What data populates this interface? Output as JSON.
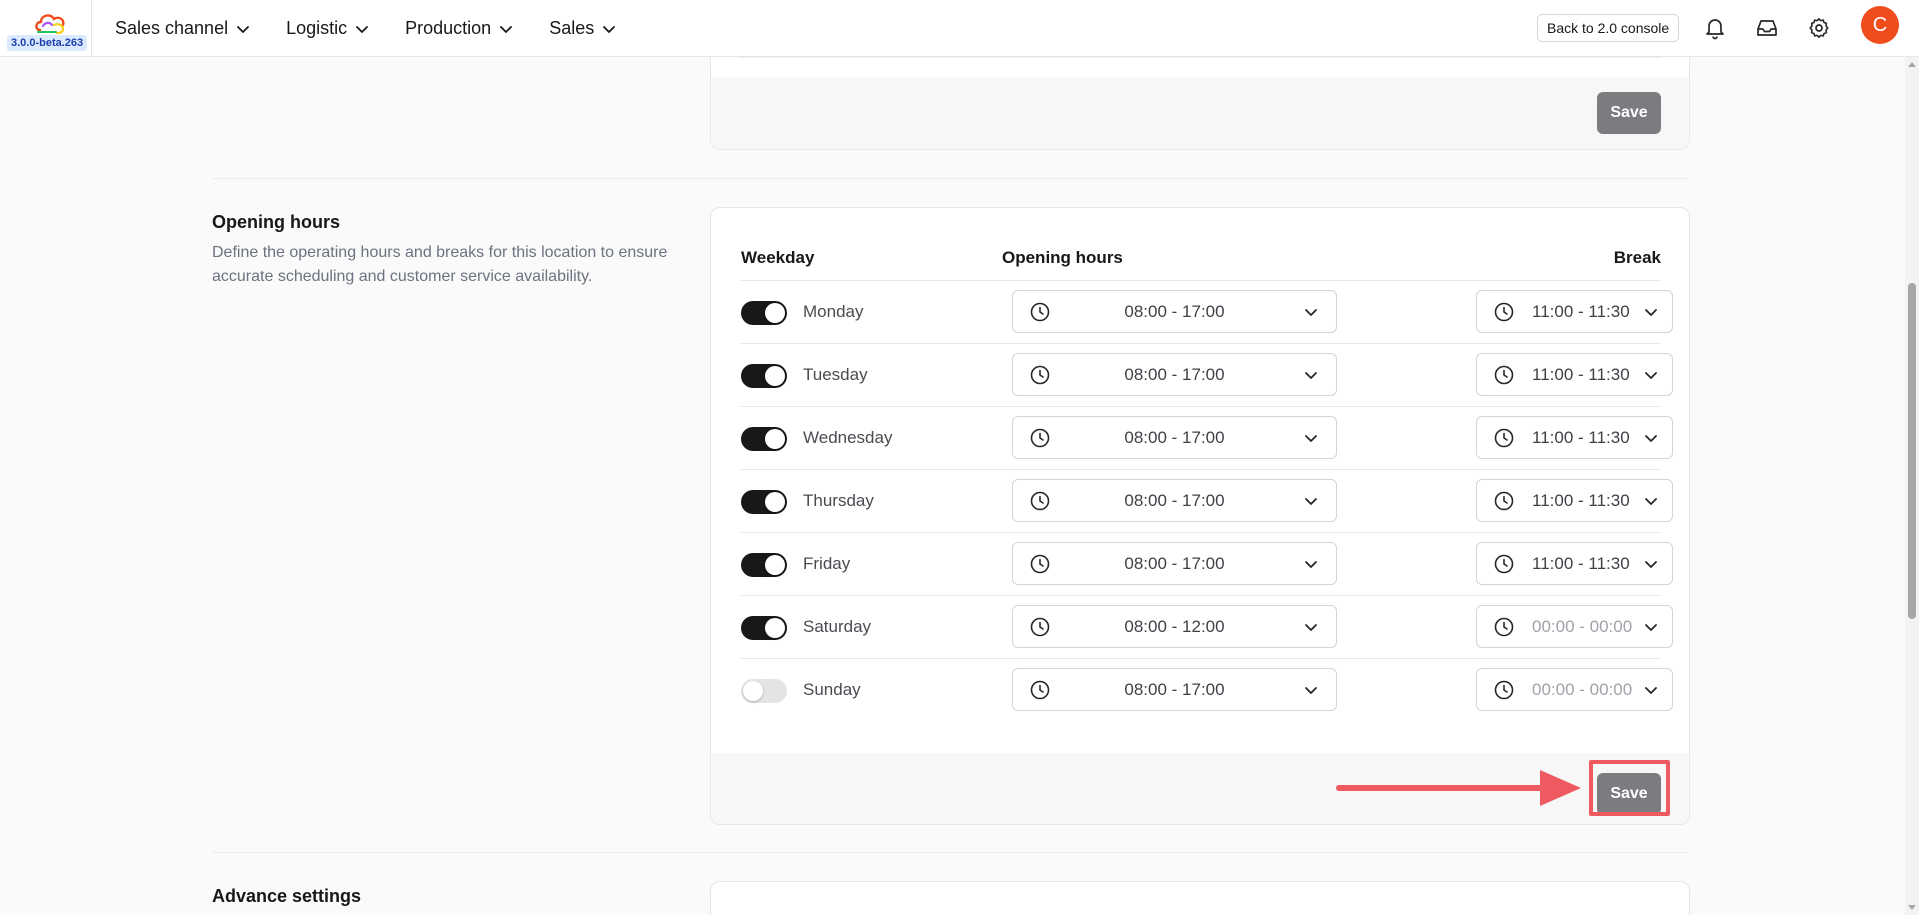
{
  "app": {
    "version": "3.0.0-beta.263",
    "brand_colors": [
      "#f04c1c",
      "#22c55e",
      "#a855f7",
      "#facc15"
    ]
  },
  "nav": {
    "items": [
      {
        "label": "Sales channel"
      },
      {
        "label": "Logistic"
      },
      {
        "label": "Production"
      },
      {
        "label": "Sales"
      }
    ],
    "console_button": "Back to 2.0 console",
    "icons": [
      "bell-icon",
      "inbox-icon",
      "gear-icon"
    ],
    "avatar_initial": "C",
    "avatar_color": "#f04c1c"
  },
  "previous_card": {
    "save_label": "Save"
  },
  "opening_hours": {
    "title": "Opening hours",
    "description": "Define the operating hours and breaks for this location to ensure accurate scheduling and customer service availability.",
    "headers": {
      "weekday": "Weekday",
      "opening": "Opening hours",
      "break": "Break"
    },
    "days": [
      {
        "name": "Monday",
        "enabled": true,
        "hours": "08:00 - 17:00",
        "break": "11:00 - 11:30",
        "break_empty": false
      },
      {
        "name": "Tuesday",
        "enabled": true,
        "hours": "08:00 - 17:00",
        "break": "11:00 - 11:30",
        "break_empty": false
      },
      {
        "name": "Wednesday",
        "enabled": true,
        "hours": "08:00 - 17:00",
        "break": "11:00 - 11:30",
        "break_empty": false
      },
      {
        "name": "Thursday",
        "enabled": true,
        "hours": "08:00 - 17:00",
        "break": "11:00 - 11:30",
        "break_empty": false
      },
      {
        "name": "Friday",
        "enabled": true,
        "hours": "08:00 - 17:00",
        "break": "11:00 - 11:30",
        "break_empty": false
      },
      {
        "name": "Saturday",
        "enabled": true,
        "hours": "08:00 - 12:00",
        "break": "00:00 - 00:00",
        "break_empty": true
      },
      {
        "name": "Sunday",
        "enabled": false,
        "hours": "08:00 - 17:00",
        "break": "00:00 - 00:00",
        "break_empty": true
      }
    ],
    "save_label": "Save",
    "annotation_color": "#ee5a5f"
  },
  "advance_settings": {
    "title": "Advance settings"
  }
}
